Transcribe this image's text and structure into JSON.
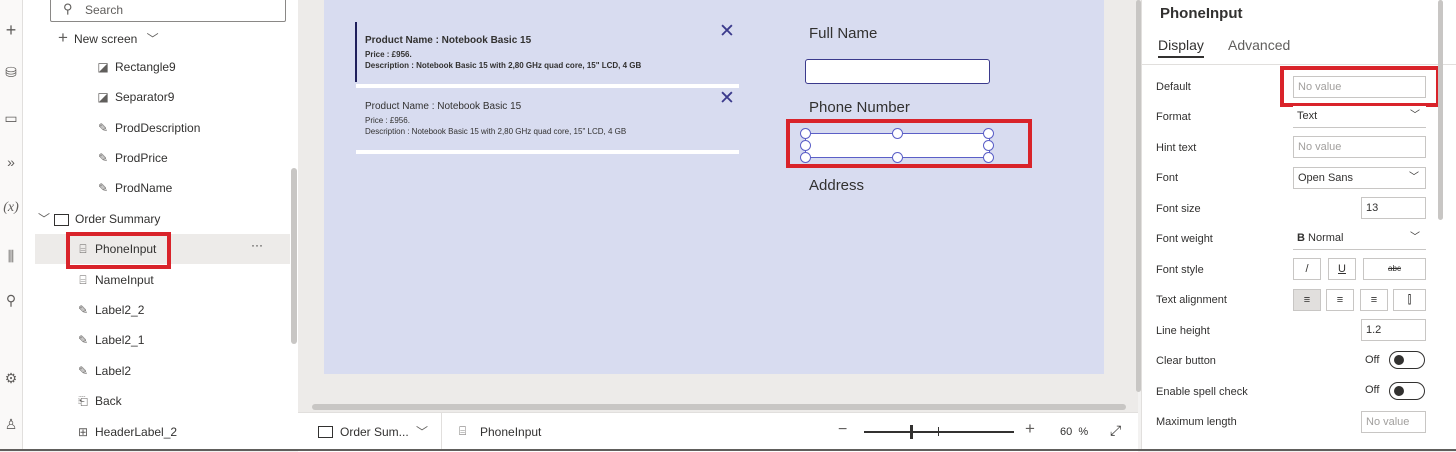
{
  "search": {
    "placeholder": "Search"
  },
  "tree": {
    "new_screen": "New screen",
    "items": [
      {
        "label": "Rectangle9",
        "icon": "shape-icon"
      },
      {
        "label": "Separator9",
        "icon": "shape-icon"
      },
      {
        "label": "ProdDescription",
        "icon": "edit-icon"
      },
      {
        "label": "ProdPrice",
        "icon": "edit-icon"
      },
      {
        "label": "ProdName",
        "icon": "edit-icon"
      }
    ],
    "group": "Order Summary",
    "children": [
      {
        "label": "PhoneInput",
        "icon": "textinput-icon",
        "selected": true
      },
      {
        "label": "NameInput",
        "icon": "textinput-icon"
      },
      {
        "label": "Label2_2",
        "icon": "edit-icon"
      },
      {
        "label": "Label2_1",
        "icon": "edit-icon"
      },
      {
        "label": "Label2",
        "icon": "edit-icon"
      },
      {
        "label": "Back",
        "icon": "back-icon"
      },
      {
        "label": "HeaderLabel_2",
        "icon": "grid-icon"
      }
    ],
    "more": "···"
  },
  "canvas": {
    "product1": {
      "name": "Product Name :  Notebook Basic 15",
      "price": "Price :  £956.",
      "desc": "Description  :  Notebook Basic 15 with 2,80 GHz quad core, 15\" LCD, 4 GB"
    },
    "product2": {
      "name": "Product Name :  Notebook Basic 15",
      "price": "Price :  £956.",
      "desc": "Description  :  Notebook Basic 15 with 2,80 GHz quad core, 15\" LCD, 4 GB"
    },
    "full_name": "Full Name",
    "phone_number": "Phone Number",
    "address": "Address",
    "close_glyph": "✕"
  },
  "status": {
    "screen": "Order Sum...",
    "control": "PhoneInput",
    "zoom": "60",
    "zoom_unit": "%"
  },
  "props": {
    "title": "PhoneInput",
    "tabs": [
      "Display",
      "Advanced"
    ],
    "rows": {
      "default": {
        "label": "Default",
        "placeholder": "No value"
      },
      "format": {
        "label": "Format",
        "value": "Text"
      },
      "hint": {
        "label": "Hint text",
        "placeholder": "No value"
      },
      "font": {
        "label": "Font",
        "value": "Open Sans"
      },
      "font_size": {
        "label": "Font size",
        "value": "13"
      },
      "font_weight": {
        "label": "Font weight",
        "value": "Normal",
        "prefix": "B"
      },
      "font_style": {
        "label": "Font style",
        "italic": "/",
        "underline": "U",
        "strike": "abc"
      },
      "text_align": {
        "label": "Text alignment"
      },
      "line_height": {
        "label": "Line height",
        "value": "1.2"
      },
      "clear_button": {
        "label": "Clear button",
        "value": "Off"
      },
      "spell_check": {
        "label": "Enable spell check",
        "value": "Off"
      },
      "max_length": {
        "label": "Maximum length",
        "placeholder": "No value"
      }
    }
  },
  "colors": {
    "accent": "#d9232a",
    "selection": "#5b5fc7",
    "screen_bg": "#d8dcf0"
  }
}
